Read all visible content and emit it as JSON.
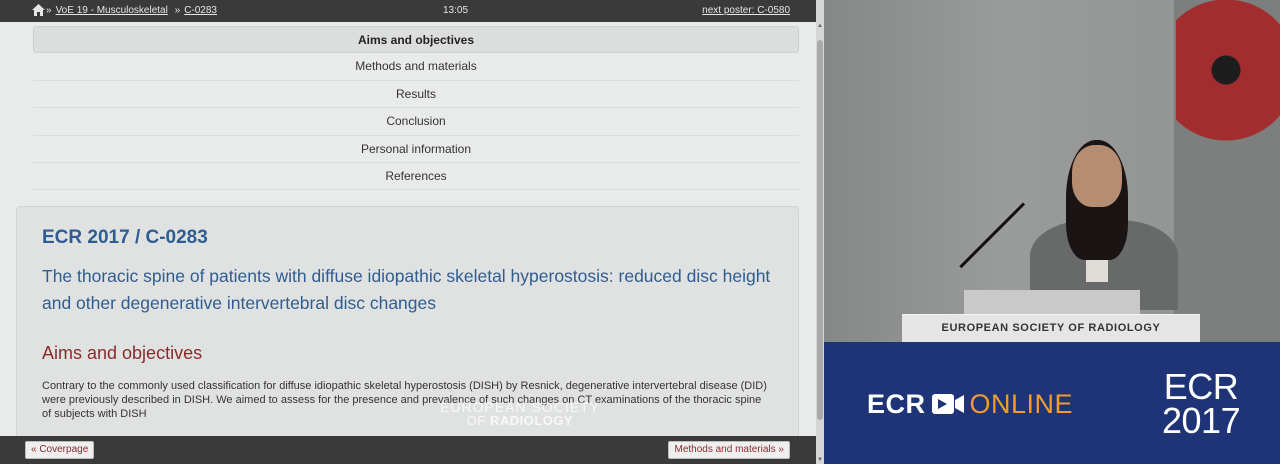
{
  "topbar": {
    "breadcrumb_1": "VoE 19 - Musculoskeletal",
    "breadcrumb_2": "C-0283",
    "time": "13:05",
    "next_poster": "next poster: C-0580"
  },
  "nav": {
    "items": [
      {
        "label": "Aims and objectives"
      },
      {
        "label": "Methods and materials"
      },
      {
        "label": "Results"
      },
      {
        "label": "Conclusion"
      },
      {
        "label": "Personal information"
      },
      {
        "label": "References"
      }
    ],
    "active_index": 0
  },
  "poster": {
    "code": "ECR 2017 / C-0283",
    "title": "The thoracic spine of patients with diffuse idiopathic skeletal hyperostosis: reduced disc height and other degenerative intervertebral disc changes",
    "section_heading": "Aims and objectives",
    "body": "Contrary to the commonly used classification for diffuse idiopathic skeletal hyperostosis (DISH) by Resnick, degenerative intervertebral disease (DID) were previously described in DISH. We aimed to assess for the presence and prevalence of such changes on CT examinations of the thoracic spine of subjects with DISH"
  },
  "bottombar": {
    "prev_label": "« Coverpage",
    "next_label": "Methods and materials »"
  },
  "watermark": {
    "line1": "EUROPEAN SOCIETY",
    "line2_a": "OF ",
    "line2_b": "RADIOLOGY"
  },
  "video": {
    "podium_label": "EUROPEAN SOCIETY OF RADIOLOGY",
    "banner_ecr": "ECR",
    "banner_online": "ONLINE",
    "year_line1": "ECR",
    "year_line2": "2017"
  },
  "colors": {
    "poster_blue": "#2f5d92",
    "section_red": "#8a2b2b",
    "banner_blue": "#1e3477",
    "online_orange": "#f29a2e"
  }
}
